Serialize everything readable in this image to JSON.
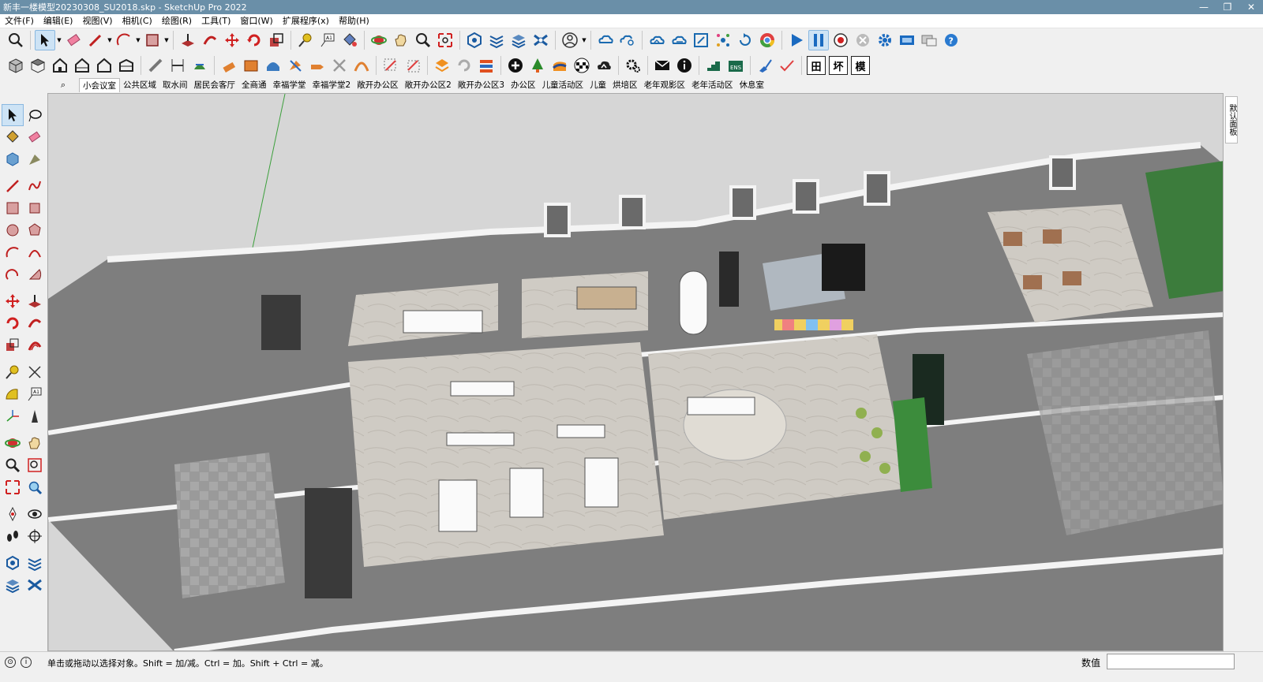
{
  "window": {
    "title": "新丰一楼模型20230308_SU2018.skp - SketchUp Pro 2022",
    "minimize": "—",
    "restore": "❐",
    "close": "✕"
  },
  "menu": [
    "文件(F)",
    "编辑(E)",
    "视图(V)",
    "相机(C)",
    "绘图(R)",
    "工具(T)",
    "窗口(W)",
    "扩展程序(x)",
    "帮助(H)"
  ],
  "toolbar2_text_buttons": [
    "田",
    "坏",
    "模"
  ],
  "scenes": {
    "active_index": 0,
    "tabs": [
      "小会议室",
      "公共区域",
      "取水间",
      "居民会客厅",
      "全商通",
      "幸福学堂",
      "幸福学堂2",
      "敞开办公区",
      "敞开办公区2",
      "敞开办公区3",
      "办公区",
      "儿童活动区",
      "儿童",
      "烘培区",
      "老年观影区",
      "老年活动区",
      "休息室"
    ]
  },
  "right_panel": {
    "tab_label": "默认面板"
  },
  "status": {
    "hint": "单击或拖动以选择对象。Shift = 加/减。Ctrl = 加。Shift + Ctrl = 减。",
    "measure_label": "数值",
    "measure_value": ""
  },
  "colors": {
    "titlebar": "#6a8fa8",
    "wall": "#8c8c8c",
    "floor": "#cfcbc4",
    "accent_green": "#3c8c3c"
  }
}
